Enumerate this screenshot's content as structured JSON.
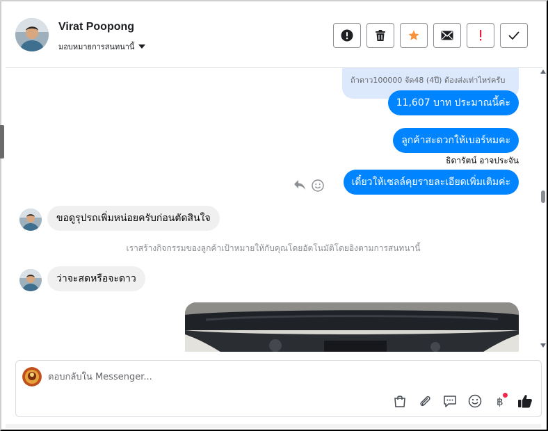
{
  "header": {
    "contact_name": "Virat Poopong",
    "assign_label": "มอบหมายการสนทนานี้",
    "actions": [
      {
        "name": "mark-spam-button",
        "icon": "alert-circle-icon"
      },
      {
        "name": "delete-button",
        "icon": "trash-icon"
      },
      {
        "name": "star-button",
        "icon": "star-icon"
      },
      {
        "name": "mark-unread-button",
        "icon": "envelope-icon"
      },
      {
        "name": "follow-up-button",
        "icon": "exclamation-icon"
      },
      {
        "name": "mark-done-button",
        "icon": "check-icon"
      }
    ],
    "star_color": "#f7923b",
    "follow_up_color": "#e41e3f"
  },
  "chat": {
    "reply_quote": "ถ้าดาว100000 จัด48 (4ปี) ต้องส่งเท่าไหร่ครับ",
    "messages_out": [
      "11,607 บาท ประมาณนี้ค่ะ",
      "ลูกค้าสะดวกให้เบอร์หมคะ",
      "เดี๋ยวให้เซลล์คุยรายละเอียดเพิ่มเติมค่ะ"
    ],
    "sender_name": "ธิดารัตน์ อาจประจัน",
    "messages_in": [
      "ขอดูรุปรถเพิ่มหน่อยครับก่อนตัดสินใจ",
      "ว่าจะสดหรือจะดาว"
    ],
    "system_note": "เราสร้างกิจกรรมของลูกค้าเป้าหมายให้กับคุณโดยอัตโนมัติโดยอิงตามการสนทนานี้",
    "outgoing_color": "#0084ff",
    "incoming_color": "#f0f0f0"
  },
  "composer": {
    "placeholder": "ตอบกลับใน Messenger...",
    "tools": [
      "shopping-bag-icon",
      "paperclip-icon",
      "saved-replies-icon",
      "emoji-icon",
      "baht-payment-icon",
      "thumbs-up-icon"
    ]
  }
}
